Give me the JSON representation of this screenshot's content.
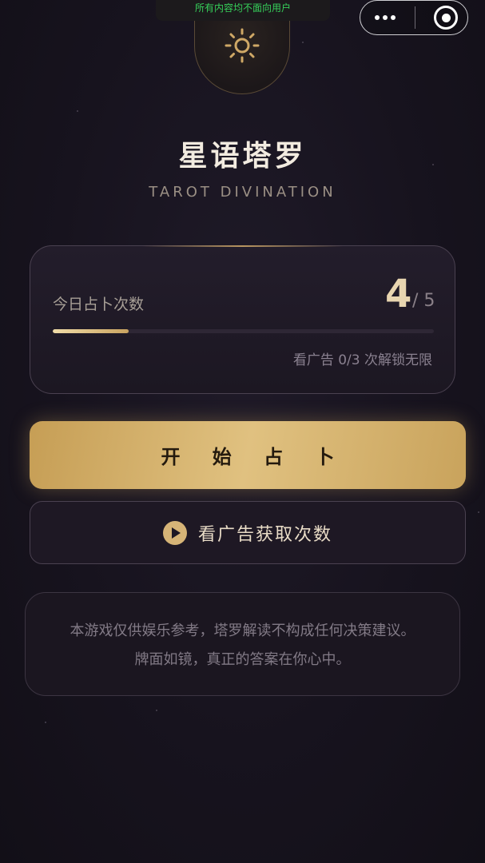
{
  "status": {
    "notice": "所有内容均不面向用户"
  },
  "app": {
    "title": "星语塔罗",
    "subtitle": "TAROT DIVINATION",
    "logo_icon": "sun-icon"
  },
  "usage": {
    "label": "今日占卜次数",
    "current": "4",
    "separator": "/",
    "total": "5",
    "progress_fraction": 0.2,
    "ad_hint": "看广告 0/3 次解锁无限"
  },
  "actions": {
    "start_label": "开 始 占 卜",
    "ad_label": "看广告获取次数",
    "ad_icon": "play-icon"
  },
  "disclaimer": {
    "line1": "本游戏仅供娱乐参考，塔罗解读不构成任何决策建议。",
    "line2": "牌面如镜，真正的答案在你心中。"
  },
  "colors": {
    "accent": "#d6b477",
    "background": "#16121c",
    "notice_text": "#36d05a"
  }
}
